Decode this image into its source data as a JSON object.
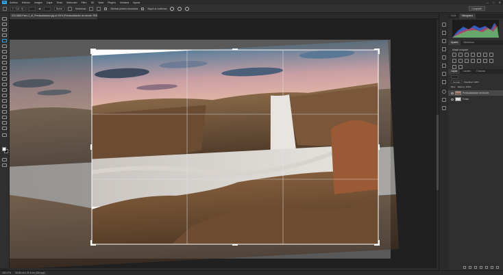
{
  "app": {
    "logo_text": "Ps"
  },
  "menu": [
    "Archivo",
    "Edición",
    "Imagen",
    "Capa",
    "Texto",
    "Selección",
    "Filtro",
    "3D",
    "Vista",
    "Plugins",
    "Ventana",
    "Ayuda"
  ],
  "window_controls": [
    "—",
    "□",
    "✕"
  ],
  "options": {
    "ratio_field": "2 : 3 (4 : 6)",
    "swap_icon": "⇄",
    "clear_label": "Borrar",
    "straighten_label": "Enderezar",
    "delete_pixels_label": "Eliminar píxeles recortados",
    "content_aware_label": "Según el contenido",
    "share_label": "Compartir"
  },
  "document_tab": {
    "label": "DSC4682-Pano-2_v2_Previsualizacion.jpg al 100% (Previsualización de recorte, RGB/8)"
  },
  "status_bar": {
    "zoom": "100,17%",
    "info": "30,28 cm x 21,5 cm (300 ppp)"
  },
  "panels": {
    "top_tabs": [
      "Color",
      "Histograma"
    ],
    "mid_tabs": [
      "Ajustes",
      "Bibliotecas"
    ],
    "adjust_label": "Añadir un ajuste",
    "layer_tabs": [
      "Capas",
      "Canales",
      "Trazados"
    ],
    "blend_mode": "Normal",
    "opacity_label": "Opacidad: 100%",
    "lock_label": "Bloq:",
    "fill_label": "Relleno: 100%",
    "layers": [
      {
        "name": "Previsualización de recorte",
        "active": true
      },
      {
        "name": "Fondo",
        "active": false
      }
    ]
  },
  "colors": {
    "accent": "#31a8ff",
    "ui_dark": "#2b2b2b",
    "canvas": "#202020"
  }
}
